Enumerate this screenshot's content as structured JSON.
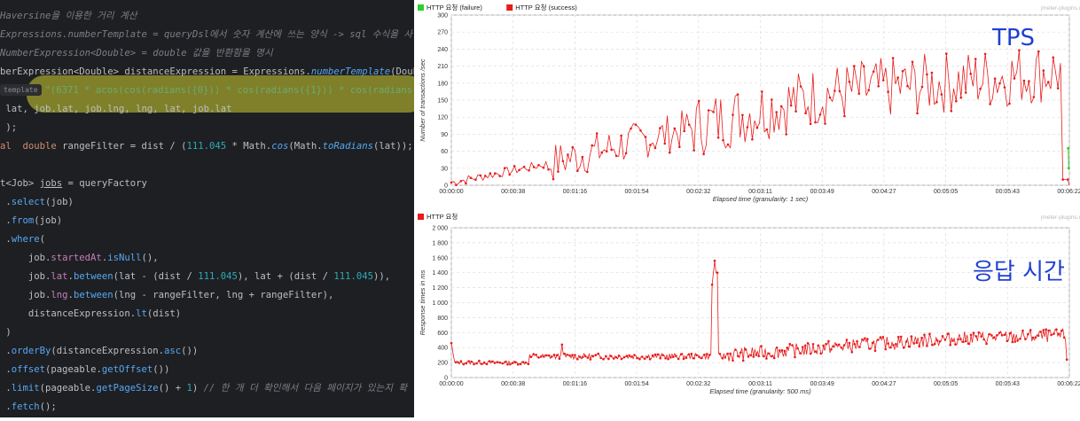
{
  "code": {
    "lines": [
      {
        "cls": "cm",
        "parts": [
          {
            "t": "Haversine을 이용한 거리 계산",
            "c": "cm"
          }
        ]
      },
      {
        "parts": [
          {
            "t": "Expressions.numberTemplate = queryDsl에서 숫자 계산에 쓰는 양식 -> sql 수식을 사",
            "c": "cm"
          }
        ]
      },
      {
        "parts": [
          {
            "t": "NumberExpression<Double> = double 값을 반환함을 명시",
            "c": "cm"
          }
        ]
      },
      {
        "parts": [
          {
            "t": "berExpression",
            "c": "ty"
          },
          {
            "t": "<Double> ",
            "c": "ty"
          },
          {
            "t": "distanceExpression",
            "c": "ty"
          },
          {
            "t": " = Expressions.",
            "c": "ty"
          },
          {
            "t": "numberTemplate",
            "c": "fn it"
          },
          {
            "t": "(Doubl",
            "c": "ty"
          }
        ]
      },
      {
        "hint": "template",
        "parts": [
          {
            "t": "\"(6371 * acos(cos(radians({0})) * cos(radians({1})) * cos(radians({",
            "c": "st"
          }
        ]
      },
      {
        "parts": [
          {
            "t": " lat, job.lat, job.lng, lng, lat, job.lat",
            "c": "ty"
          }
        ]
      },
      {
        "parts": [
          {
            "t": " );",
            "c": "ty"
          }
        ]
      },
      {
        "parts": [
          {
            "t": "al  ",
            "c": "kw"
          },
          {
            "t": "double ",
            "c": "kw"
          },
          {
            "t": "rangeFilter = dist / (",
            "c": "ty"
          },
          {
            "t": "111.045",
            "c": "nm"
          },
          {
            "t": " * Math.",
            "c": "ty"
          },
          {
            "t": "cos",
            "c": "fn it"
          },
          {
            "t": "(Math.",
            "c": "ty"
          },
          {
            "t": "toRadians",
            "c": "fn it"
          },
          {
            "t": "(lat));",
            "c": "ty"
          }
        ]
      },
      {
        "parts": [
          {
            "t": "",
            "c": "ty"
          }
        ]
      },
      {
        "parts": [
          {
            "t": "t<Job> ",
            "c": "ty"
          },
          {
            "t": "jobs",
            "c": "ty ul"
          },
          {
            "t": " = queryFactory",
            "c": "ty"
          }
        ]
      },
      {
        "parts": [
          {
            "t": " .",
            "c": "ty"
          },
          {
            "t": "select",
            "c": "fn"
          },
          {
            "t": "(job)",
            "c": "ty"
          }
        ]
      },
      {
        "parts": [
          {
            "t": " .",
            "c": "ty"
          },
          {
            "t": "from",
            "c": "fn"
          },
          {
            "t": "(job)",
            "c": "ty"
          }
        ]
      },
      {
        "parts": [
          {
            "t": " .",
            "c": "ty"
          },
          {
            "t": "where",
            "c": "fn"
          },
          {
            "t": "(",
            "c": "ty"
          }
        ]
      },
      {
        "parts": [
          {
            "t": "     job.",
            "c": "ty"
          },
          {
            "t": "startedAt",
            "c": "fl"
          },
          {
            "t": ".",
            "c": "ty"
          },
          {
            "t": "isNull",
            "c": "fn"
          },
          {
            "t": "(),",
            "c": "ty"
          }
        ]
      },
      {
        "parts": [
          {
            "t": "     job.",
            "c": "ty"
          },
          {
            "t": "lat",
            "c": "fl"
          },
          {
            "t": ".",
            "c": "ty"
          },
          {
            "t": "between",
            "c": "fn"
          },
          {
            "t": "(lat - (dist / ",
            "c": "ty"
          },
          {
            "t": "111.045",
            "c": "nm"
          },
          {
            "t": "), lat + (dist / ",
            "c": "ty"
          },
          {
            "t": "111.045",
            "c": "nm"
          },
          {
            "t": ")),",
            "c": "ty"
          }
        ]
      },
      {
        "parts": [
          {
            "t": "     job.",
            "c": "ty"
          },
          {
            "t": "lng",
            "c": "fl"
          },
          {
            "t": ".",
            "c": "ty"
          },
          {
            "t": "between",
            "c": "fn"
          },
          {
            "t": "(lng - rangeFilter, lng + rangeFilter),",
            "c": "ty"
          }
        ]
      },
      {
        "parts": [
          {
            "t": "     distanceExpression.",
            "c": "ty"
          },
          {
            "t": "lt",
            "c": "fn"
          },
          {
            "t": "(dist)",
            "c": "ty"
          }
        ]
      },
      {
        "parts": [
          {
            "t": " )",
            "c": "ty"
          }
        ]
      },
      {
        "parts": [
          {
            "t": " .",
            "c": "ty"
          },
          {
            "t": "orderBy",
            "c": "fn"
          },
          {
            "t": "(distanceExpression.",
            "c": "ty"
          },
          {
            "t": "asc",
            "c": "fn"
          },
          {
            "t": "())",
            "c": "ty"
          }
        ]
      },
      {
        "parts": [
          {
            "t": " .",
            "c": "ty"
          },
          {
            "t": "offset",
            "c": "fn"
          },
          {
            "t": "(pageable.",
            "c": "ty"
          },
          {
            "t": "getOffset",
            "c": "fn"
          },
          {
            "t": "())",
            "c": "ty"
          }
        ]
      },
      {
        "parts": [
          {
            "t": " .",
            "c": "ty"
          },
          {
            "t": "limit",
            "c": "fn"
          },
          {
            "t": "(pageable.",
            "c": "ty"
          },
          {
            "t": "getPageSize",
            "c": "fn"
          },
          {
            "t": "() + ",
            "c": "ty"
          },
          {
            "t": "1",
            "c": "nm"
          },
          {
            "t": ") ",
            "c": "ty"
          },
          {
            "t": "// 한 개 더 확인해서 다음 페이지가 있는지 확",
            "c": "cm"
          }
        ]
      },
      {
        "parts": [
          {
            "t": " .",
            "c": "ty"
          },
          {
            "t": "fetch",
            "c": "fn"
          },
          {
            "t": "();",
            "c": "ty"
          }
        ]
      }
    ]
  },
  "overlays": {
    "tps": "TPS",
    "response": "응답 시간"
  },
  "colors": {
    "failure": "#2bd12b",
    "success": "#e81b1b",
    "overlay": "#1f3fd0"
  },
  "chart_data": [
    {
      "type": "line",
      "legend": [
        {
          "name": "HTTP 요청 (failure)",
          "color": "#2bd12b"
        },
        {
          "name": "HTTP 요청 (success)",
          "color": "#e81b1b"
        }
      ],
      "watermark": "jmeter-plugins.org",
      "xlabel": "Elapsed time (granularity: 1 sec)",
      "ylabel": "Number of transactions /sec",
      "xticks": [
        "00:00:00",
        "00:00:38",
        "00:01:16",
        "00:01:54",
        "00:02:32",
        "00:03:11",
        "00:03:49",
        "00:04:27",
        "00:05:05",
        "00:05:43",
        "00:06:22"
      ],
      "yticks": [
        0,
        30,
        60,
        90,
        120,
        150,
        180,
        210,
        240,
        270,
        300
      ],
      "ylim": [
        0,
        300
      ],
      "xlim_seconds": [
        0,
        382
      ],
      "series_shape": {
        "trend": "rising from ~5 to ~200 tps, noisy",
        "points": 382
      }
    },
    {
      "type": "line",
      "legend": [
        {
          "name": "HTTP 요청",
          "color": "#e81b1b"
        }
      ],
      "watermark": "jmeter-plugins.org",
      "xlabel": "Elapsed time (granularity: 500 ms)",
      "ylabel": "Response times in ms",
      "xticks": [
        "00:00:00",
        "00:00:38",
        "00:01:16",
        "00:01:54",
        "00:02:32",
        "00:03:11",
        "00:03:49",
        "00:04:27",
        "00:05:05",
        "00:05:43",
        "00:06:22"
      ],
      "yticks": [
        "0",
        "200",
        "400",
        "600",
        "800",
        "1 000",
        "1 200",
        "1 400",
        "1 600",
        "1 800",
        "2 000"
      ],
      "ylim": [
        0,
        2000
      ],
      "xlim_seconds": [
        0,
        382
      ],
      "series_shape": {
        "trend": "~200 ms early, spike ~1600 ms near 00:02:45, rising to ~600 ms",
        "points": 764
      }
    }
  ]
}
